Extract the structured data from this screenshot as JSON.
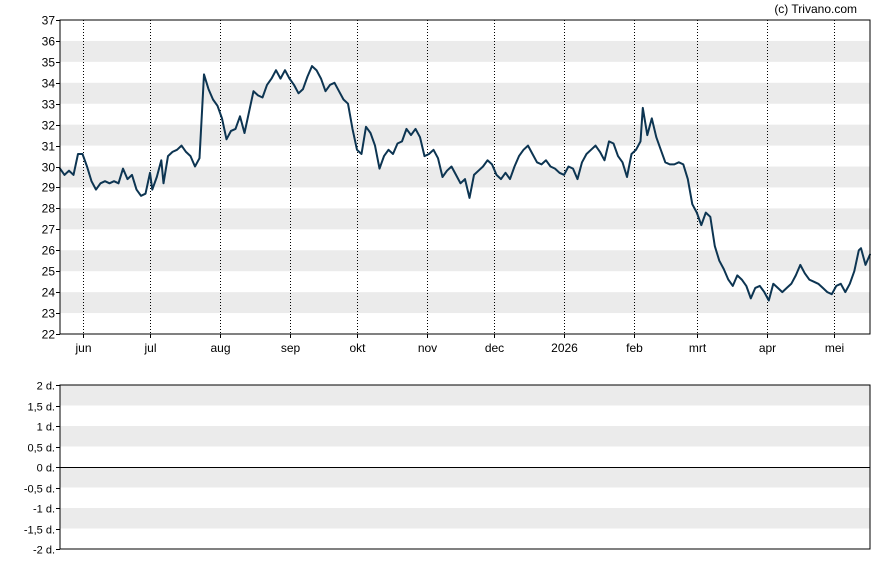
{
  "credit": "(c) Trivano.com",
  "colors": {
    "line": "#0d3552",
    "band": "#ebebeb",
    "grid": "#000000",
    "frame": "#000000",
    "text": "#000000"
  },
  "chart_data": [
    {
      "type": "line",
      "ylim": [
        22,
        37
      ],
      "yticks": [
        22,
        23,
        24,
        25,
        26,
        27,
        28,
        29,
        30,
        31,
        32,
        33,
        34,
        35,
        36,
        37
      ],
      "x_tick_labels": [
        "jun",
        "jul",
        "aug",
        "sep",
        "okt",
        "nov",
        "dec",
        "2026",
        "feb",
        "mrt",
        "apr",
        "mei"
      ],
      "x_dates": [
        "2025-06-01",
        "2025-07-01",
        "2025-08-01",
        "2025-09-01",
        "2025-10-01",
        "2025-11-01",
        "2025-12-01",
        "2026-01-01",
        "2026-02-01",
        "2026-03-01",
        "2026-04-01",
        "2026-05-01"
      ],
      "alternating_bands": true,
      "vertical_grid": "dotted",
      "series": [
        {
          "points": [
            [
              "2025-05-22",
              29.9
            ],
            [
              "2025-05-24",
              29.6
            ],
            [
              "2025-05-26",
              29.8
            ],
            [
              "2025-05-28",
              29.6
            ],
            [
              "2025-05-30",
              30.6
            ],
            [
              "2025-06-01",
              30.6
            ],
            [
              "2025-06-03",
              30.0
            ],
            [
              "2025-06-05",
              29.3
            ],
            [
              "2025-06-07",
              28.9
            ],
            [
              "2025-06-09",
              29.2
            ],
            [
              "2025-06-11",
              29.3
            ],
            [
              "2025-06-13",
              29.2
            ],
            [
              "2025-06-15",
              29.3
            ],
            [
              "2025-06-17",
              29.2
            ],
            [
              "2025-06-19",
              29.9
            ],
            [
              "2025-06-21",
              29.4
            ],
            [
              "2025-06-23",
              29.6
            ],
            [
              "2025-06-25",
              28.9
            ],
            [
              "2025-06-27",
              28.6
            ],
            [
              "2025-06-29",
              28.7
            ],
            [
              "2025-07-01",
              29.7
            ],
            [
              "2025-07-02",
              28.9
            ],
            [
              "2025-07-04",
              29.5
            ],
            [
              "2025-07-06",
              30.3
            ],
            [
              "2025-07-07",
              29.2
            ],
            [
              "2025-07-09",
              30.5
            ],
            [
              "2025-07-11",
              30.7
            ],
            [
              "2025-07-13",
              30.8
            ],
            [
              "2025-07-15",
              31.0
            ],
            [
              "2025-07-17",
              30.7
            ],
            [
              "2025-07-19",
              30.5
            ],
            [
              "2025-07-21",
              30.0
            ],
            [
              "2025-07-23",
              30.4
            ],
            [
              "2025-07-25",
              34.4
            ],
            [
              "2025-07-27",
              33.7
            ],
            [
              "2025-07-29",
              33.2
            ],
            [
              "2025-07-31",
              32.9
            ],
            [
              "2025-08-02",
              32.3
            ],
            [
              "2025-08-04",
              31.3
            ],
            [
              "2025-08-06",
              31.7
            ],
            [
              "2025-08-08",
              31.8
            ],
            [
              "2025-08-10",
              32.4
            ],
            [
              "2025-08-12",
              31.6
            ],
            [
              "2025-08-14",
              32.6
            ],
            [
              "2025-08-16",
              33.6
            ],
            [
              "2025-08-18",
              33.4
            ],
            [
              "2025-08-20",
              33.3
            ],
            [
              "2025-08-22",
              33.9
            ],
            [
              "2025-08-24",
              34.2
            ],
            [
              "2025-08-26",
              34.6
            ],
            [
              "2025-08-28",
              34.2
            ],
            [
              "2025-08-30",
              34.6
            ],
            [
              "2025-09-01",
              34.2
            ],
            [
              "2025-09-03",
              33.9
            ],
            [
              "2025-09-05",
              33.5
            ],
            [
              "2025-09-07",
              33.7
            ],
            [
              "2025-09-09",
              34.3
            ],
            [
              "2025-09-11",
              34.8
            ],
            [
              "2025-09-13",
              34.6
            ],
            [
              "2025-09-15",
              34.2
            ],
            [
              "2025-09-17",
              33.6
            ],
            [
              "2025-09-19",
              33.9
            ],
            [
              "2025-09-21",
              34.0
            ],
            [
              "2025-09-23",
              33.6
            ],
            [
              "2025-09-25",
              33.2
            ],
            [
              "2025-09-27",
              33.0
            ],
            [
              "2025-09-29",
              31.8
            ],
            [
              "2025-10-01",
              30.8
            ],
            [
              "2025-10-03",
              30.6
            ],
            [
              "2025-10-05",
              31.9
            ],
            [
              "2025-10-07",
              31.6
            ],
            [
              "2025-10-09",
              31.0
            ],
            [
              "2025-10-11",
              29.9
            ],
            [
              "2025-10-13",
              30.5
            ],
            [
              "2025-10-15",
              30.8
            ],
            [
              "2025-10-17",
              30.6
            ],
            [
              "2025-10-19",
              31.1
            ],
            [
              "2025-10-21",
              31.2
            ],
            [
              "2025-10-23",
              31.8
            ],
            [
              "2025-10-25",
              31.5
            ],
            [
              "2025-10-27",
              31.8
            ],
            [
              "2025-10-29",
              31.4
            ],
            [
              "2025-10-31",
              30.5
            ],
            [
              "2025-11-02",
              30.6
            ],
            [
              "2025-11-04",
              30.8
            ],
            [
              "2025-11-06",
              30.4
            ],
            [
              "2025-11-08",
              29.5
            ],
            [
              "2025-11-10",
              29.8
            ],
            [
              "2025-11-12",
              30.0
            ],
            [
              "2025-11-14",
              29.6
            ],
            [
              "2025-11-16",
              29.2
            ],
            [
              "2025-11-18",
              29.4
            ],
            [
              "2025-11-20",
              28.5
            ],
            [
              "2025-11-22",
              29.6
            ],
            [
              "2025-11-24",
              29.8
            ],
            [
              "2025-11-26",
              30.0
            ],
            [
              "2025-11-28",
              30.3
            ],
            [
              "2025-11-30",
              30.1
            ],
            [
              "2025-12-02",
              29.6
            ],
            [
              "2025-12-04",
              29.4
            ],
            [
              "2025-12-06",
              29.7
            ],
            [
              "2025-12-08",
              29.4
            ],
            [
              "2025-12-10",
              30.0
            ],
            [
              "2025-12-12",
              30.5
            ],
            [
              "2025-12-14",
              30.8
            ],
            [
              "2025-12-16",
              31.0
            ],
            [
              "2025-12-18",
              30.6
            ],
            [
              "2025-12-20",
              30.2
            ],
            [
              "2025-12-22",
              30.1
            ],
            [
              "2025-12-24",
              30.3
            ],
            [
              "2025-12-26",
              30.0
            ],
            [
              "2025-12-28",
              29.9
            ],
            [
              "2025-12-30",
              29.7
            ],
            [
              "2026-01-01",
              29.6
            ],
            [
              "2026-01-03",
              30.0
            ],
            [
              "2026-01-05",
              29.9
            ],
            [
              "2026-01-07",
              29.4
            ],
            [
              "2026-01-09",
              30.2
            ],
            [
              "2026-01-11",
              30.6
            ],
            [
              "2026-01-13",
              30.8
            ],
            [
              "2026-01-15",
              31.0
            ],
            [
              "2026-01-17",
              30.7
            ],
            [
              "2026-01-19",
              30.3
            ],
            [
              "2026-01-21",
              31.2
            ],
            [
              "2026-01-23",
              31.1
            ],
            [
              "2026-01-25",
              30.5
            ],
            [
              "2026-01-27",
              30.2
            ],
            [
              "2026-01-29",
              29.5
            ],
            [
              "2026-01-31",
              30.6
            ],
            [
              "2026-02-02",
              30.8
            ],
            [
              "2026-02-04",
              31.2
            ],
            [
              "2026-02-05",
              32.8
            ],
            [
              "2026-02-07",
              31.5
            ],
            [
              "2026-02-09",
              32.3
            ],
            [
              "2026-02-11",
              31.4
            ],
            [
              "2026-02-13",
              30.8
            ],
            [
              "2026-02-15",
              30.2
            ],
            [
              "2026-02-17",
              30.1
            ],
            [
              "2026-02-19",
              30.1
            ],
            [
              "2026-02-21",
              30.2
            ],
            [
              "2026-02-23",
              30.1
            ],
            [
              "2026-02-25",
              29.4
            ],
            [
              "2026-02-27",
              28.2
            ],
            [
              "2026-03-01",
              27.8
            ],
            [
              "2026-03-03",
              27.2
            ],
            [
              "2026-03-05",
              27.8
            ],
            [
              "2026-03-07",
              27.6
            ],
            [
              "2026-03-09",
              26.2
            ],
            [
              "2026-03-11",
              25.5
            ],
            [
              "2026-03-13",
              25.1
            ],
            [
              "2026-03-15",
              24.6
            ],
            [
              "2026-03-17",
              24.3
            ],
            [
              "2026-03-19",
              24.8
            ],
            [
              "2026-03-21",
              24.6
            ],
            [
              "2026-03-23",
              24.3
            ],
            [
              "2026-03-25",
              23.7
            ],
            [
              "2026-03-27",
              24.2
            ],
            [
              "2026-03-29",
              24.3
            ],
            [
              "2026-03-31",
              24.0
            ],
            [
              "2026-04-02",
              23.6
            ],
            [
              "2026-04-04",
              24.4
            ],
            [
              "2026-04-06",
              24.2
            ],
            [
              "2026-04-08",
              24.0
            ],
            [
              "2026-04-10",
              24.2
            ],
            [
              "2026-04-12",
              24.4
            ],
            [
              "2026-04-14",
              24.8
            ],
            [
              "2026-04-16",
              25.3
            ],
            [
              "2026-04-18",
              24.9
            ],
            [
              "2026-04-20",
              24.6
            ],
            [
              "2026-04-22",
              24.5
            ],
            [
              "2026-04-24",
              24.4
            ],
            [
              "2026-04-26",
              24.2
            ],
            [
              "2026-04-28",
              24.0
            ],
            [
              "2026-04-30",
              23.9
            ],
            [
              "2026-05-02",
              24.3
            ],
            [
              "2026-05-04",
              24.4
            ],
            [
              "2026-05-06",
              24.0
            ],
            [
              "2026-05-08",
              24.4
            ],
            [
              "2026-05-10",
              25.0
            ],
            [
              "2026-05-12",
              26.0
            ],
            [
              "2026-05-13",
              26.1
            ],
            [
              "2026-05-15",
              25.3
            ],
            [
              "2026-05-17",
              25.8
            ]
          ]
        }
      ]
    },
    {
      "type": "line",
      "ylim": [
        -2,
        2
      ],
      "ytick_labels": [
        "2 d.",
        "1,5 d.",
        "1 d.",
        "0,5 d.",
        "0 d.",
        "-0,5 d.",
        "-1 d.",
        "-1,5 d.",
        "-2 d."
      ],
      "zero_line": true,
      "alternating_bands": true,
      "series": []
    }
  ]
}
